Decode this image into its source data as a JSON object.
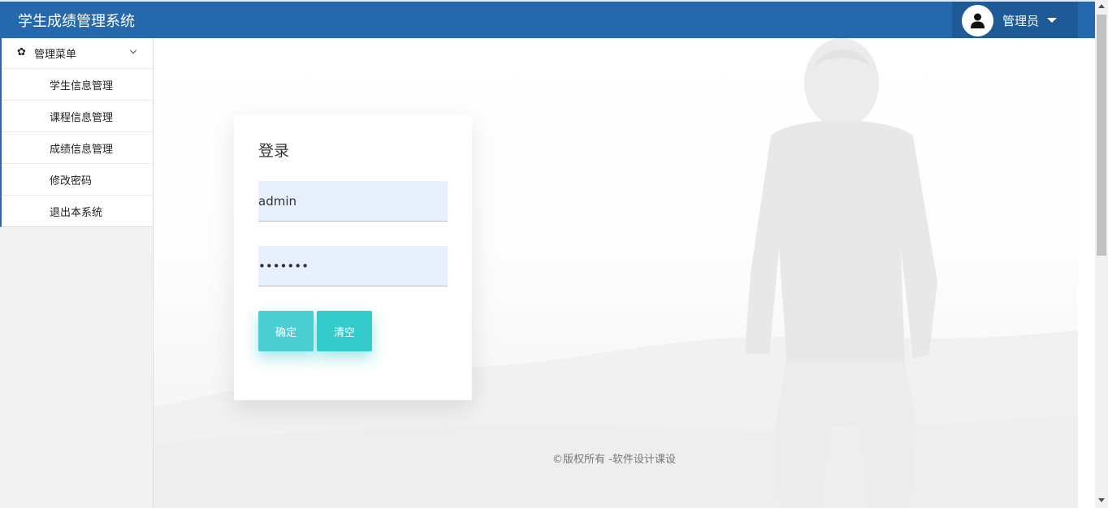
{
  "app": {
    "title": "学生成绩管理系统"
  },
  "header": {
    "user_label": "管理员",
    "user_icon": "user-icon",
    "caret_icon": "caret-down-icon"
  },
  "sidebar": {
    "menu_title": "管理菜单",
    "menu_icon": "gear-icon",
    "items": [
      {
        "label": "学生信息管理"
      },
      {
        "label": "课程信息管理"
      },
      {
        "label": "成绩信息管理"
      },
      {
        "label": "修改密码"
      },
      {
        "label": "退出本系统"
      }
    ]
  },
  "login": {
    "title": "登录",
    "username_value": "admin",
    "password_value": "1234567",
    "confirm_label": "确定",
    "clear_label": "清空"
  },
  "footer": {
    "text": "©版权所有 -软件设计课设"
  },
  "colors": {
    "header_bg": "#2568ab",
    "user_area_bg": "#1d5a96",
    "button_bg": "#4bcfd2",
    "input_bg": "#e8f0fe"
  }
}
